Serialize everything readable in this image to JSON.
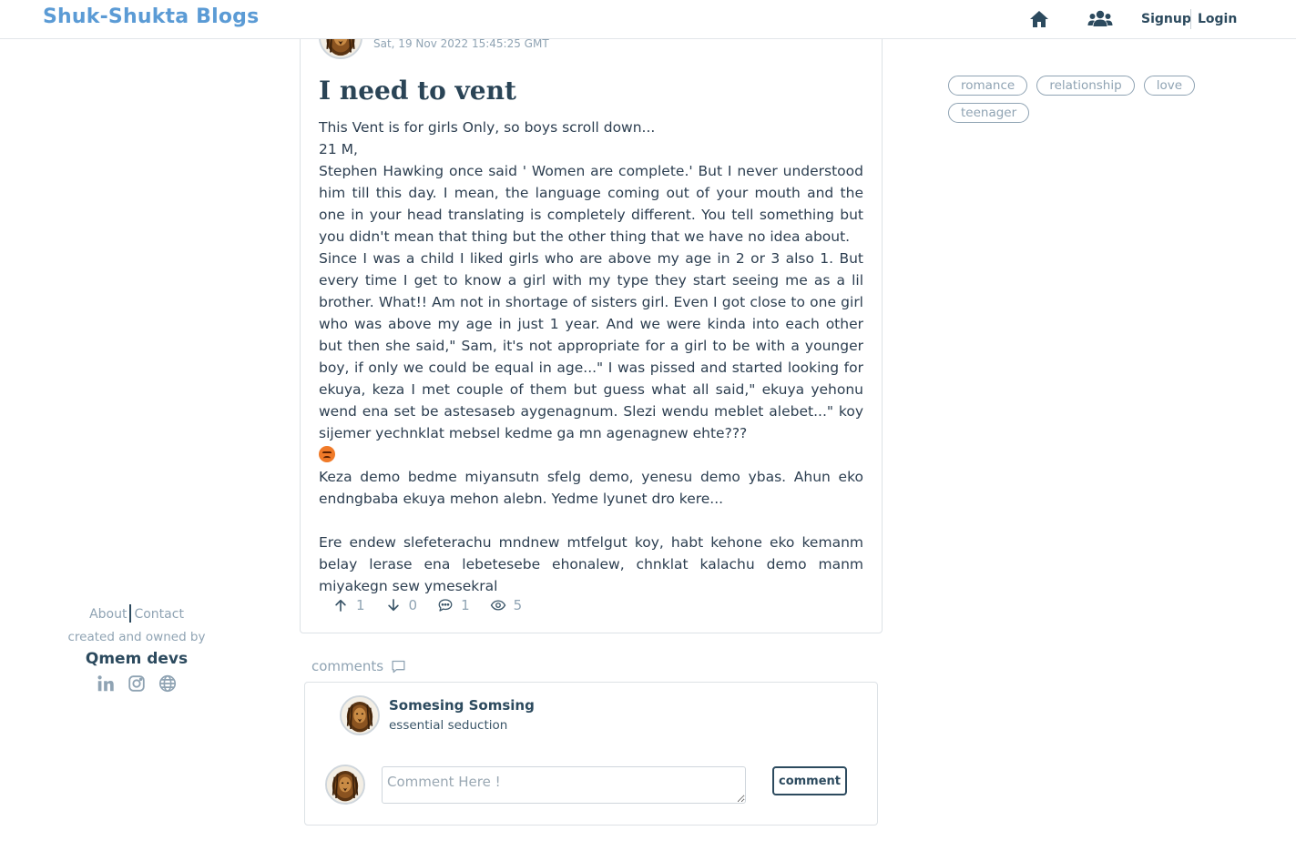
{
  "header": {
    "brand": "Shuk-Shukta Blogs",
    "home_icon": "home-icon",
    "users_icon": "users-icon",
    "signup_label": "Signup",
    "login_label": "Login"
  },
  "post": {
    "date": "Sat, 19 Nov 2022 15:45:25 GMT",
    "title": "I need to vent",
    "paragraphs": [
      "This Vent is for girls Only, so boys scroll down...",
      "21 M,",
      "Stephen Hawking once said ' Women are complete.' But I never understood him till this day. I mean, the language coming out of your mouth and the one in your head translating is completely different. You tell something but you didn't mean that thing but the other thing that we have no idea about.",
      "Since I was a child I liked girls who are above my age in 2 or 3 also 1. But every time I get to know a girl with my type they start seeing me as a lil brother. What!! Am not in shortage of sisters girl. Even I got close to one girl who was above my age in just 1 year. And we were kinda into each other but then she said,\" Sam, it's not appropriate for a girl to be with a younger boy, if only we could be equal in age...\" I was pissed and started looking for ekuya, keza I met couple of them but guess what all said,\" ekuya yehonu wend ena set be astesaseb aygenagnum. Slezi wendu meblet alebet...\" koy sijemer yechnklat mebsel kedme ga mn agenagnew ehte???",
      "Keza demo bedme miyansutn sfelg demo, yenesu demo ybas. Ahun eko endngbaba ekuya mehon alebn. Yedme lyunet dro kere...",
      "Ere endew slefeterachu mndnew mtfelgut koy, habt kehone eko kemanm belay lerase ena lebetesebe ehonalew, chnklat kalachu demo manm miyakegn sew ymesekral"
    ],
    "emoji_icon": "angry-face-icon",
    "stats": {
      "upvotes": "1",
      "downvotes": "0",
      "comments": "1",
      "views": "5"
    }
  },
  "comments": {
    "label": "comments",
    "items": [
      {
        "author": "Somesing Somsing",
        "text": "essential seduction"
      }
    ],
    "input_placeholder": "Comment Here !",
    "submit_label": "comment"
  },
  "tags": [
    "romance",
    "relationship",
    "love",
    "teenager"
  ],
  "footer": {
    "about": "About",
    "contact": "Contact",
    "owned_by": "created and owned by",
    "devs": "Qmem devs",
    "social_icons": [
      "linkedin-icon",
      "instagram-icon",
      "globe-icon"
    ]
  },
  "colors": {
    "brand": "#5b9bd5",
    "primary_dark": "#2c4a5e",
    "muted": "#8fa3b3",
    "border": "#dde2e6"
  }
}
